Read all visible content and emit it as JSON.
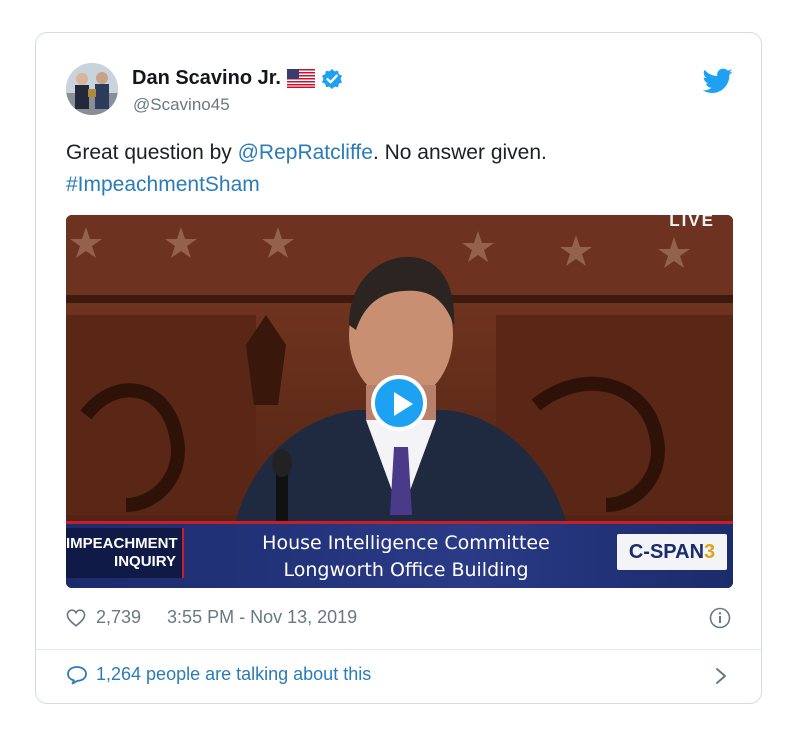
{
  "tweet": {
    "author_name": "Dan Scavino Jr.",
    "handle": "@Scavino45",
    "text_prefix": "Great question by ",
    "mention": "@RepRatcliffe",
    "text_suffix": ". No answer given.",
    "hashtag": "#ImpeachmentSham"
  },
  "media": {
    "live_label": "LIVE",
    "chyron_left_line1": "IMPEACHMENT",
    "chyron_left_line2": "INQUIRY",
    "chyron_title_line1": "House Intelligence Committee",
    "chyron_title_line2": "Longworth Office Building",
    "network_logo_a": "C-SPAN",
    "network_logo_b": "3"
  },
  "footer": {
    "likes": "2,739",
    "timestamp": "3:55 PM - Nov 13, 2019",
    "conversation": "1,264 people are talking about this"
  },
  "colors": {
    "link": "#2b7bb9",
    "twitter_blue": "#1da1f2",
    "muted": "#697882"
  },
  "icons": [
    "flag-icon",
    "verified-badge-icon",
    "twitter-bird-icon",
    "play-icon",
    "heart-icon",
    "info-icon",
    "comment-bubble-icon",
    "chevron-right-icon"
  ]
}
